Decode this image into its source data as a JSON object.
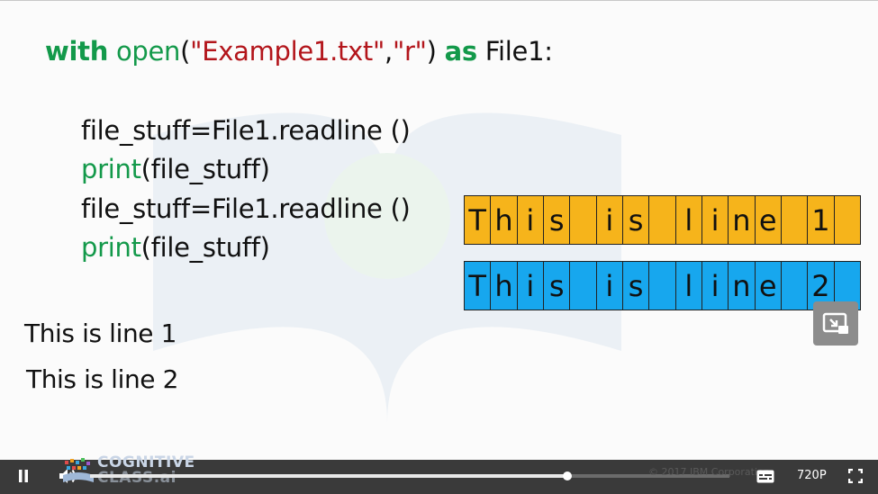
{
  "slide": {
    "code_line1": {
      "kw_with": "with",
      "fn_open": "open",
      "paren_open": "(",
      "arg1": "\"Example1.txt\"",
      "comma": ",",
      "arg2": "\"r\"",
      "paren_close": ")",
      "kw_as": "as",
      "var": "File1:"
    },
    "code_line2": "file_stuff=File1.readline ()",
    "code_line3": {
      "fn": "print",
      "args": "(file_stuff)"
    },
    "code_line4": "file_stuff=File1.readline ()",
    "code_line5": {
      "fn": "print",
      "args": "(file_stuff)"
    },
    "output_line1": "This is line 1",
    "output_line2": "This is line 2",
    "line1_chars": [
      "T",
      "h",
      "i",
      "s",
      "",
      "i",
      "s",
      "",
      "l",
      "i",
      "n",
      "e",
      "",
      "1",
      ""
    ],
    "line2_chars": [
      "T",
      "h",
      "i",
      "s",
      "",
      "i",
      "s",
      "",
      "l",
      "i",
      "n",
      "e",
      "",
      "2",
      ""
    ],
    "colors": {
      "line1_fill": "#f6b41b",
      "line2_fill": "#17a7ee",
      "keyword": "#13994a",
      "string": "#b3151b"
    }
  },
  "controls": {
    "play_state_icon": "pause-icon",
    "volume_icon": "volume-icon",
    "logo_text_top": "COGNITIVE",
    "logo_text_bottom": "CLASS.ai",
    "progress_fraction": 0.746,
    "copyright": "© 2017 IBM Corporation",
    "quality": "720P",
    "captions_icon": "captions-icon",
    "fullscreen_icon": "fullscreen-icon",
    "pip_icon": "picture-in-picture-icon"
  }
}
